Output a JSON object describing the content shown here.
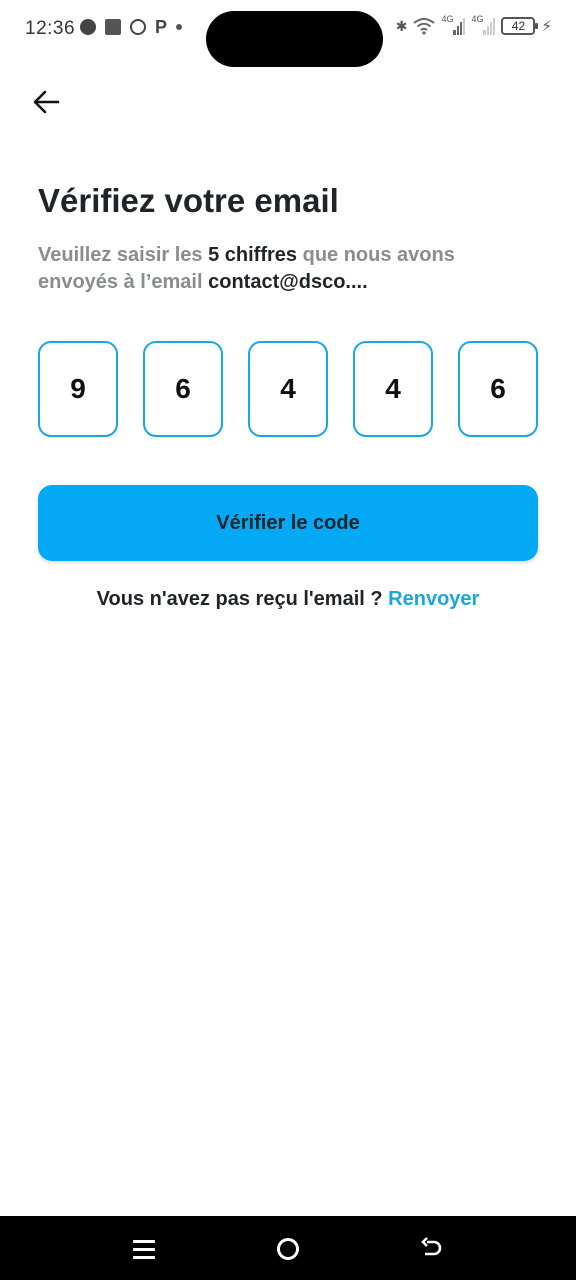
{
  "status_bar": {
    "time": "12:36",
    "battery": "42",
    "signal_label_1": "4G",
    "signal_label_2": "4G"
  },
  "header": {
    "back_icon": "arrow-left-icon"
  },
  "page": {
    "title": "Vérifiez votre email",
    "subtitle_part1": "Veuillez saisir les ",
    "subtitle_bold1": "5 chiffres",
    "subtitle_part2": " que nous avons envoyés à l’email ",
    "subtitle_bold2": "contact@dsco...."
  },
  "code": {
    "digits": [
      "9",
      "6",
      "4",
      "4",
      "6"
    ],
    "border_color": "#1aa7e0"
  },
  "verify_button": {
    "label": "Vérifier le code",
    "color": "#03a9f4"
  },
  "resend": {
    "prompt": "Vous n'avez pas reçu l'email ? ",
    "link_label": "Renvoyer",
    "link_color": "#1aa7e0"
  },
  "nav_bar": {
    "menu_icon": "recent-apps-icon",
    "home_icon": "home-icon",
    "back_icon": "back-icon"
  }
}
